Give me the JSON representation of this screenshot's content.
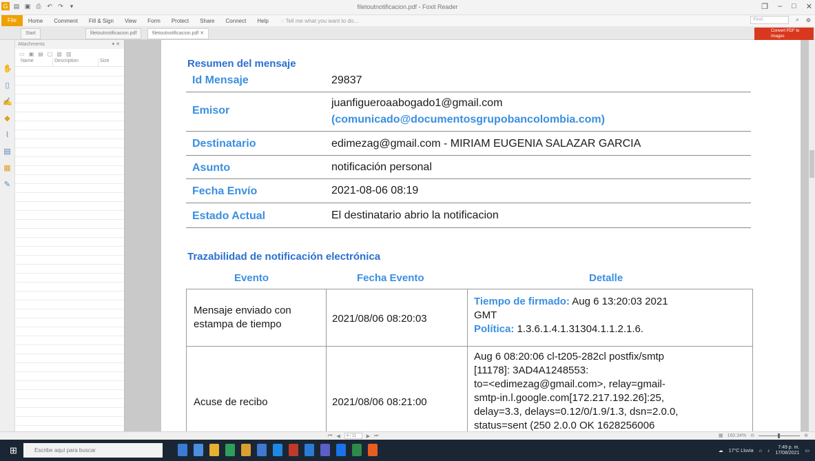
{
  "app": {
    "title": "filetoutnotificacion.pdf - Foxit Reader",
    "menus": [
      "Home",
      "Comment",
      "Fill & Sign",
      "View",
      "Form",
      "Protect",
      "Share",
      "Connect",
      "Help"
    ],
    "file_menu": "File",
    "tell_me": "Tell me what you want to do...",
    "find_placeholder": "Find",
    "tabs": [
      "Start",
      "filetoutnotificacion.pdf",
      "filetoutnotificacion.pdf"
    ],
    "ad_text": "Convert PDF to Images",
    "accent_color": "#f0a000"
  },
  "attachments_panel": {
    "title": "Attachments",
    "columns": [
      "Name",
      "Description",
      "Size"
    ]
  },
  "document": {
    "summary_title": "Resumen del mensaje",
    "summary_rows": [
      {
        "label": "Id Mensaje",
        "value": "29837"
      },
      {
        "label": "Emisor",
        "value": "juanfigueroaabogado1@gmail.com",
        "value2": "(comunicado@documentosgrupobancolombia.com)"
      },
      {
        "label": "Destinatario",
        "value": "edimezag@gmail.com - MIRIAM EUGENIA SALAZAR GARCIA"
      },
      {
        "label": "Asunto",
        "value": "notificación personal"
      },
      {
        "label": "Fecha Envío",
        "value": "2021-08-06 08:19"
      },
      {
        "label": "Estado Actual",
        "value": "El destinatario abrio la notificacion"
      }
    ],
    "trace_title": "Trazabilidad de notificación electrónica",
    "trace_headers": [
      "Evento",
      "Fecha Evento",
      "Detalle"
    ],
    "trace_rows": [
      {
        "event": [
          "Mensaje enviado con",
          "estampa de tiempo"
        ],
        "date": "2021/08/06 08:20:03",
        "detail_label1": "Tiempo de firmado:",
        "detail_value1a": " Aug 6 13:20:03 2021",
        "detail_value1b": "GMT",
        "detail_label2": "Política:",
        "detail_value2": " 1.3.6.1.4.1.31304.1.1.2.1.6."
      },
      {
        "event": [
          "Acuse de recibo"
        ],
        "date": "2021/08/06 08:21:00",
        "detail_lines": [
          "Aug 6 08:20:06 cl-t205-282cl postfix/smtp",
          "[11178]: 3AD4A1248553:",
          "to=<edimezag@gmail.com>, relay=gmail-",
          "smtp-in.l.google.com[172.217.192.26]:25,",
          "delay=3.3, delays=0.12/0/1.9/1.3, dsn=2.0.0,",
          "status=sent (250 2.0.0 OK 1628256006"
        ]
      }
    ],
    "label_color": "#3a8fe0"
  },
  "statusbar": {
    "page": "4 / 11",
    "zoom": "160.34%"
  },
  "taskbar": {
    "search_placeholder": "Escribe aquí para buscar",
    "weather": "17°C Lluvia",
    "time": "7:49 p. m.",
    "date": "17/08/2021"
  }
}
